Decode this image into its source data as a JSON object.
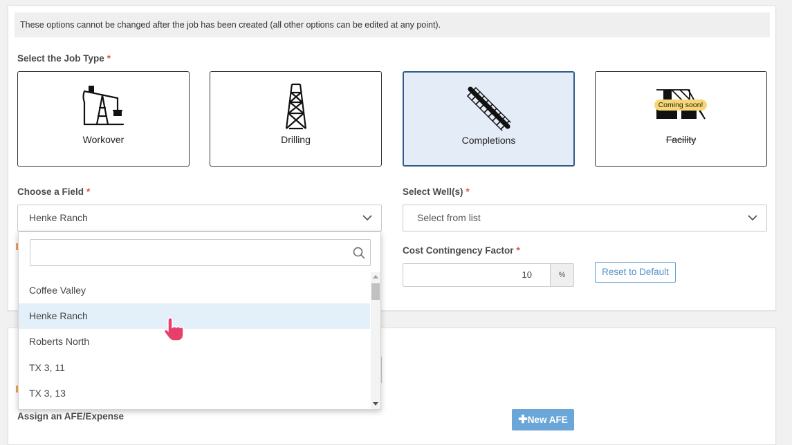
{
  "notice": "These options cannot be changed after the job has been created (all other options can be edited at any point).",
  "job_type": {
    "label": "Select the Job Type",
    "required_mark": "*",
    "options": [
      {
        "name": "Workover",
        "icon": "pumpjack-icon",
        "selected": false
      },
      {
        "name": "Drilling",
        "icon": "drilling-rig-icon",
        "selected": false
      },
      {
        "name": "Completions",
        "icon": "completions-icon",
        "selected": true
      },
      {
        "name": "Facility",
        "icon": "facility-icon",
        "selected": false,
        "disabled": true,
        "badge": "Coming soon!"
      }
    ]
  },
  "field": {
    "label": "Choose a Field",
    "required_mark": "*",
    "value": "Henke Ranch",
    "dropdown": {
      "search_placeholder": "",
      "items": [
        "Coffee Valley",
        "Henke Ranch",
        "Roberts North",
        "TX 3, 11",
        "TX 3, 13"
      ],
      "hovered": "Henke Ranch"
    }
  },
  "wells": {
    "label": "Select Well(s)",
    "required_mark": "*",
    "placeholder": "Select from list"
  },
  "contingency": {
    "label": "Cost Contingency Factor",
    "required_mark": "*",
    "value": "10",
    "unit": "%",
    "reset_label": "Reset to Default"
  },
  "afe": {
    "label": "Assign an AFE/Expense",
    "new_button": "New AFE"
  },
  "colors": {
    "accent": "#4f8fcb",
    "selected_bg": "#e4ecf7",
    "selected_border": "#2e5c8a",
    "required": "#d9534f",
    "badge": "#f7d774",
    "cursor": "#e83e6c"
  }
}
